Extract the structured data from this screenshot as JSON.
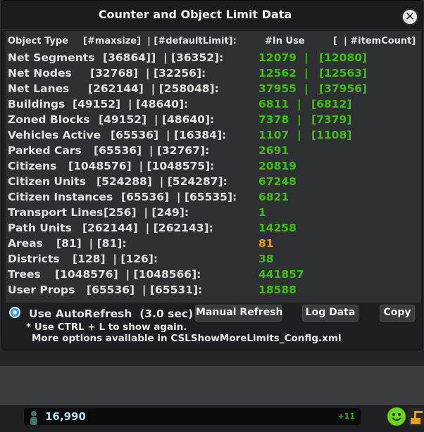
{
  "window": {
    "title": "Counter and Object Limit Data",
    "close_label": "✕"
  },
  "header": {
    "object_type": "Object Type",
    "limits": "[#maxsize]  | [#defaultLimit]:",
    "in_use": "#In Use",
    "item_count": "[  | #itemCount]"
  },
  "rows": [
    {
      "label": "Net Segments",
      "limits": "[36864]]  | [36352]:",
      "in_use": "12079",
      "sep": "|",
      "count": "[12080]"
    },
    {
      "label": "Net Nodes",
      "limits": "[32768]  | [32256]:",
      "in_use": "12562",
      "sep": "|",
      "count": "[12563]"
    },
    {
      "label": "Net Lanes",
      "limits": "[262144]  | [258048]:",
      "in_use": "37955",
      "sep": "|",
      "count": "[37956]"
    },
    {
      "label": "Buildings",
      "limits": "[49152]  | [48640]:",
      "in_use": "6811",
      "sep": "|",
      "count": "[6812]"
    },
    {
      "label": "Zoned Blocks",
      "limits": "[49152]  | [48640]:",
      "in_use": "7378",
      "sep": "|",
      "count": "[7379]"
    },
    {
      "label": "Vehicles Active",
      "limits": "[65536]  | [16384]:",
      "in_use": "1107",
      "sep": "|",
      "count": "[1108]"
    },
    {
      "label": "Parked Cars",
      "limits": "[65536]  | [32767]:",
      "in_use": "2691",
      "sep": "",
      "count": ""
    },
    {
      "label": "Citizens",
      "limits": "[1048576]  | [1048575]:",
      "in_use": "20819",
      "sep": "",
      "count": ""
    },
    {
      "label": "Citizen Units",
      "limits": "[524288]  | [524287]:",
      "in_use": "67248",
      "sep": "",
      "count": ""
    },
    {
      "label": "Citizen Instances",
      "limits": "[65536]  | [65535]:",
      "in_use": "6821",
      "sep": "",
      "count": ""
    },
    {
      "label": "Transport Lines",
      "limits": "[256]  | [249]:",
      "in_use": "1",
      "sep": "",
      "count": ""
    },
    {
      "label": "Path Units",
      "limits": "[262144]  | [262143]:",
      "in_use": "14258",
      "sep": "",
      "count": ""
    },
    {
      "label": "Areas",
      "limits": "[81]  | [81]:",
      "in_use": "81",
      "sep": "",
      "count": ""
    },
    {
      "label": "Districts",
      "limits": "[128]  | [126]:",
      "in_use": "38",
      "sep": "",
      "count": ""
    },
    {
      "label": "Trees",
      "limits": "[1048576]  | [1048566]:",
      "in_use": "441857",
      "sep": "",
      "count": ""
    },
    {
      "label": "User Props",
      "limits": "[65536]  | [65531]:",
      "in_use": "18588",
      "sep": "",
      "count": ""
    }
  ],
  "controls": {
    "autorefresh_label": "Use AutoRefresh  (3.0 sec)",
    "autorefresh_checked": true,
    "manual_refresh": "Manual Refresh",
    "log_data": "Log Data",
    "copy": "Copy",
    "hint_line1": "* Use CTRL + L to show again.",
    "hint_line2": "More options available in CSLShowMoreLimits_Config.xml"
  },
  "statusbar": {
    "population": "16,990",
    "population_delta": "+11",
    "person_icon": "person-icon",
    "happiness_icon": "smiley-icon"
  },
  "colors": {
    "in_use_normal": "#3ec10d",
    "in_use_warning": "#e9a20e",
    "accent_radio": "#2f9ae0"
  }
}
